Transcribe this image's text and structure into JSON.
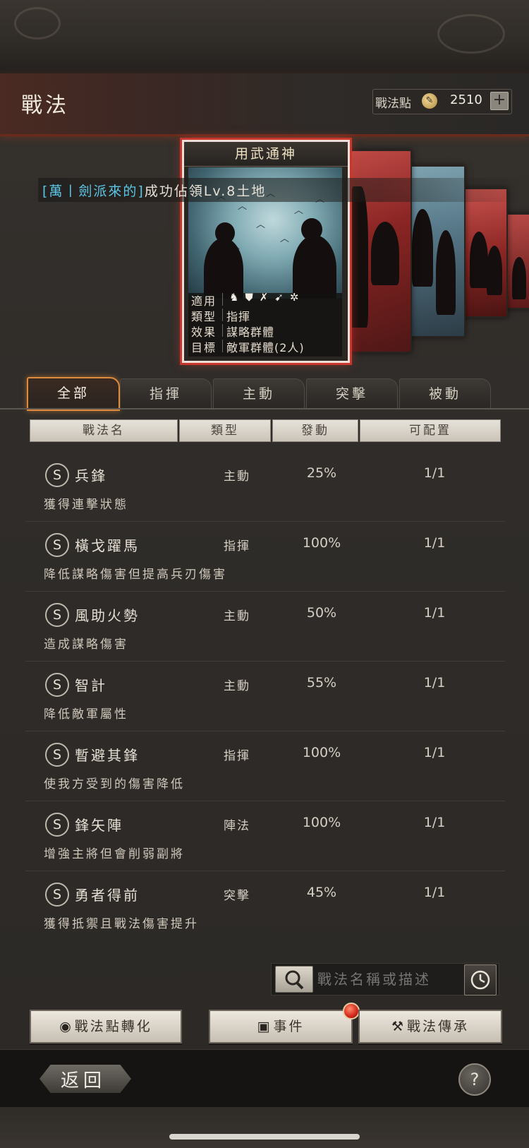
{
  "header": {
    "title": "戰法",
    "points_label": "戰法點",
    "points_value": "2510",
    "points_add": "+"
  },
  "notice": {
    "prefix": "[",
    "player": "萬丨劍派來的]",
    "message": "成功佔領Lv.8土地"
  },
  "featured_card": {
    "title": "用武通神",
    "stats": [
      {
        "key": "適用",
        "value": ""
      },
      {
        "key": "類型",
        "value": "指揮"
      },
      {
        "key": "效果",
        "value": "謀略群體"
      },
      {
        "key": "目標",
        "value": "敵軍群體(2人)"
      }
    ],
    "unit_icons": [
      "cavalry-icon",
      "shield-icon",
      "bow-icon",
      "spear-icon",
      "wheel-icon"
    ]
  },
  "tabs": [
    {
      "label": "全部",
      "active": true
    },
    {
      "label": "指揮",
      "active": false
    },
    {
      "label": "主動",
      "active": false
    },
    {
      "label": "突擊",
      "active": false
    },
    {
      "label": "被動",
      "active": false
    }
  ],
  "columns": [
    "戰法名",
    "類型",
    "發動",
    "可配置"
  ],
  "tactics": [
    {
      "grade": "S",
      "name": "兵鋒",
      "type": "主動",
      "rate": "25%",
      "config": "1/1",
      "desc": "獲得連擊狀態"
    },
    {
      "grade": "S",
      "name": "橫戈躍馬",
      "type": "指揮",
      "rate": "100%",
      "config": "1/1",
      "desc": "降低謀略傷害但提高兵刃傷害"
    },
    {
      "grade": "S",
      "name": "風助火勢",
      "type": "主動",
      "rate": "50%",
      "config": "1/1",
      "desc": "造成謀略傷害"
    },
    {
      "grade": "S",
      "name": "智計",
      "type": "主動",
      "rate": "55%",
      "config": "1/1",
      "desc": "降低敵軍屬性"
    },
    {
      "grade": "S",
      "name": "暫避其鋒",
      "type": "指揮",
      "rate": "100%",
      "config": "1/1",
      "desc": "使我方受到的傷害降低"
    },
    {
      "grade": "S",
      "name": "鋒矢陣",
      "type": "陣法",
      "rate": "100%",
      "config": "1/1",
      "desc": "增強主將但會削弱副將"
    },
    {
      "grade": "S",
      "name": "勇者得前",
      "type": "突擊",
      "rate": "45%",
      "config": "1/1",
      "desc": "獲得抵禦且戰法傷害提升"
    }
  ],
  "search": {
    "placeholder": "戰法名稱或描述"
  },
  "actions": {
    "convert": "戰法點轉化",
    "events": "事件",
    "inherit": "戰法傳承"
  },
  "footer": {
    "back": "返回",
    "help": "?"
  },
  "colors": {
    "accent_orange": "#e08a3c",
    "card_border_red": "#c8362c",
    "player_name_blue": "#5cc6e6"
  }
}
